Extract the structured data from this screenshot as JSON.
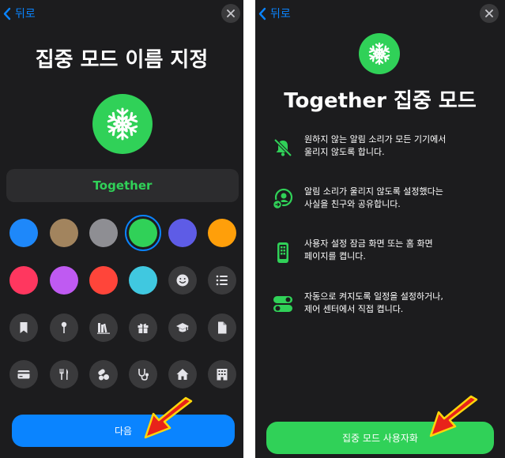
{
  "colors": {
    "accent_blue": "#0a84ff",
    "accent_green": "#30d158",
    "pointer_arrow": "#e8231a"
  },
  "left_screen": {
    "back_label": "뒤로",
    "title": "집중 모드 이름 지정",
    "name_field": {
      "value": "Together",
      "placeholder": ""
    },
    "selected_color": "green",
    "swatches": [
      {
        "name": "blue",
        "color": "#1e88fa"
      },
      {
        "name": "tan",
        "color": "#a2845e"
      },
      {
        "name": "gray",
        "color": "#8e8e93"
      },
      {
        "name": "green",
        "color": "#30d158"
      },
      {
        "name": "indigo",
        "color": "#5e5ce6"
      },
      {
        "name": "orange",
        "color": "#ff9f0a"
      },
      {
        "name": "pink",
        "color": "#ff375f"
      },
      {
        "name": "purple",
        "color": "#bf5af2"
      },
      {
        "name": "red",
        "color": "#ff453a"
      },
      {
        "name": "cyan",
        "color": "#40c8e0"
      }
    ],
    "icons": [
      "smiley-icon",
      "list-icon",
      "bookmark-icon",
      "pin-icon",
      "books-icon",
      "gift-icon",
      "graduation-cap-icon",
      "document-icon",
      "credit-card-icon",
      "fork-knife-icon",
      "pills-icon",
      "stethoscope-icon",
      "house-icon",
      "building-icon"
    ],
    "next_button": "다음"
  },
  "right_screen": {
    "back_label": "뒤로",
    "title": "Together 집중 모드",
    "features": [
      {
        "icon": "bell-slash-icon",
        "text": "원하지 않는 알림 소리가 모든 기기에서\n울리지 않도록 합니다."
      },
      {
        "icon": "person-share-icon",
        "text": "알림 소리가 울리지 않도록 설정했다는\n사실을 친구와 공유합니다."
      },
      {
        "icon": "phone-screen-icon",
        "text": "사용자 설정 잠금 화면 또는 홈 화면\n페이지를 켭니다."
      },
      {
        "icon": "toggles-icon",
        "text": "자동으로 켜지도록 일정을 설정하거나,\n제어 센터에서 직접 켭니다."
      }
    ],
    "enable_button": "집중 모드 사용자화"
  }
}
